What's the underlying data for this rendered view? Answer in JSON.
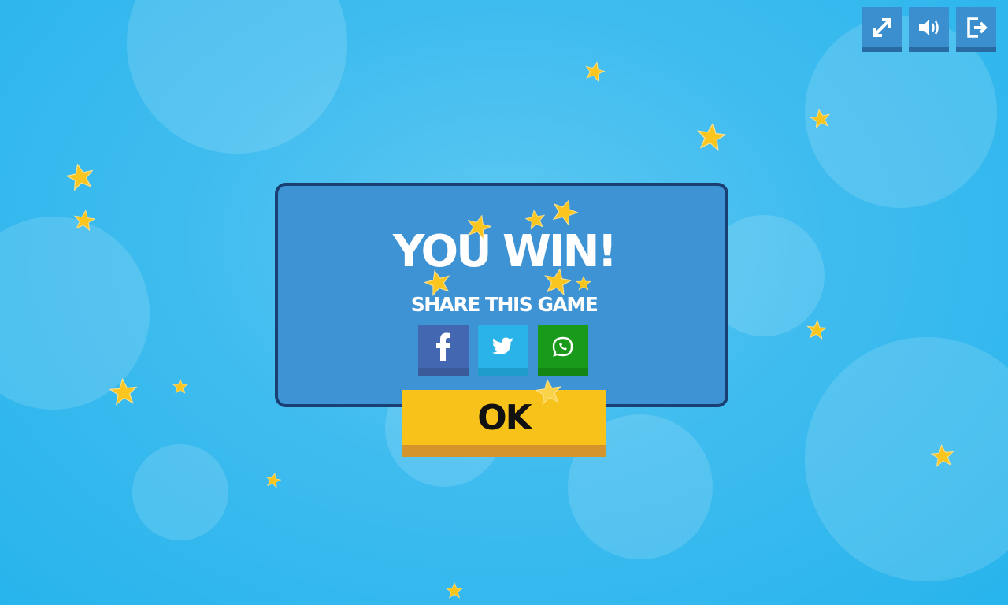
{
  "game": {
    "title": "YOU WIN!",
    "subtitle": "SHARE THIS GAME",
    "ok_label": "OK"
  },
  "controls": [
    {
      "icon": "fullscreen-icon"
    },
    {
      "icon": "sound-icon"
    },
    {
      "icon": "exit-icon"
    }
  ],
  "share": [
    {
      "icon": "facebook-icon",
      "color": "#4367b0"
    },
    {
      "icon": "twitter-icon",
      "color": "#29b3e8"
    },
    {
      "icon": "whatsapp-icon",
      "color": "#199a1a"
    }
  ],
  "colors": {
    "background": "#3fbcef",
    "panel": "#3d93d3",
    "panel_border": "#1a3f73",
    "ok_button": "#f7c21a",
    "star": "#f9c51e"
  }
}
